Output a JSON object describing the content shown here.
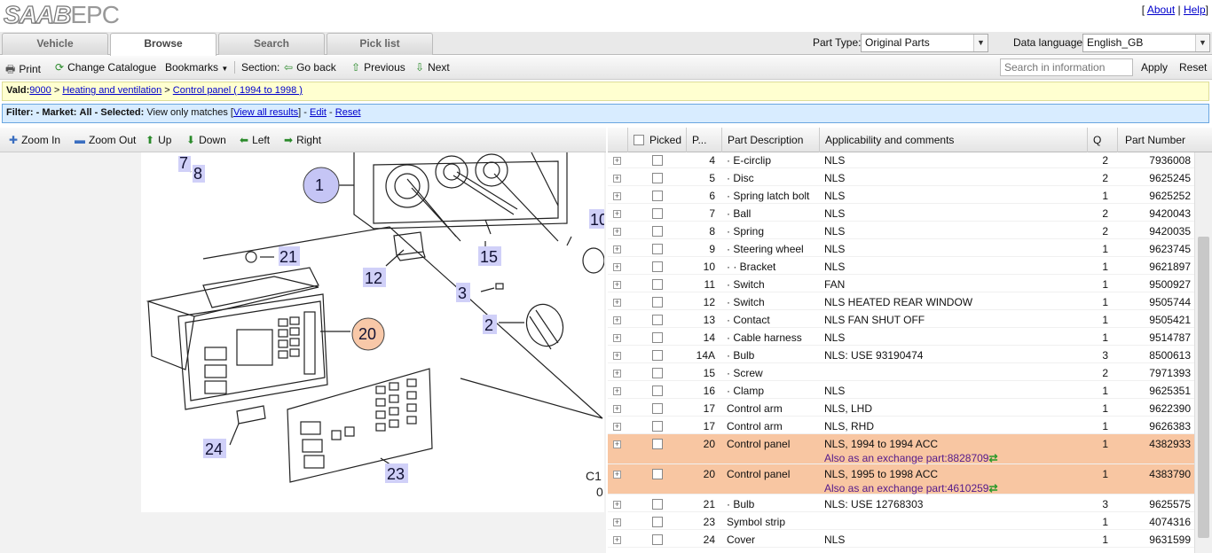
{
  "brand": {
    "logo_bold": "SAAB",
    "logo_light": "EPC"
  },
  "top_links": {
    "about": "About",
    "help": "Help"
  },
  "tabs": [
    "Vehicle",
    "Browse",
    "Search",
    "Pick list"
  ],
  "part_type": {
    "label": "Part Type:",
    "value": "Original Parts"
  },
  "data_language": {
    "label": "Data language:",
    "value": "English_GB"
  },
  "toolbar": {
    "print": "Print",
    "change_catalogue": "Change Catalogue",
    "bookmarks": "Bookmarks",
    "section": "Section:",
    "go_back": "Go back",
    "previous": "Previous",
    "next": "Next",
    "search_placeholder": "Search in information",
    "apply": "Apply",
    "reset": "Reset"
  },
  "breadcrumb": {
    "label": "Vald:",
    "model": "9000",
    "group": "Heating and ventilation",
    "section": "Control panel ( 1994 to 1998 )"
  },
  "filter": {
    "label": "Filter:",
    "market_label": "- Market:",
    "market": "All",
    "selected_label": "- Selected:",
    "selected": "View only matches",
    "view_all": "View all results",
    "edit": "Edit",
    "reset": "Reset"
  },
  "image_toolbar": {
    "zoom_in": "Zoom In",
    "zoom_out": "Zoom Out",
    "up": "Up",
    "down": "Down",
    "left": "Left",
    "right": "Right"
  },
  "diagram_labels": {
    "c1": "C1",
    "c0": "0"
  },
  "colors": {
    "highlight_row": "#f8c6a2",
    "valid_bg": "#ffffd0",
    "filter_bg": "#d8ecff",
    "callout_blue": "#c5c5f5",
    "callout_orange": "#f8c8a8"
  },
  "table": {
    "headers": [
      "Picked",
      "P...",
      "Part Description",
      "Applicability and comments",
      "Q",
      "Part Number"
    ],
    "rows": [
      {
        "pos": "4",
        "desc": "· E-circlip",
        "app": "NLS",
        "q": "2",
        "num": "7936008"
      },
      {
        "pos": "5",
        "desc": "· Disc",
        "app": "NLS",
        "q": "2",
        "num": "9625245"
      },
      {
        "pos": "6",
        "desc": "· Spring latch bolt",
        "app": "NLS",
        "q": "1",
        "num": "9625252"
      },
      {
        "pos": "7",
        "desc": "· Ball",
        "app": "NLS",
        "q": "2",
        "num": "9420043"
      },
      {
        "pos": "8",
        "desc": "· Spring",
        "app": "NLS",
        "q": "2",
        "num": "9420035"
      },
      {
        "pos": "9",
        "desc": "· Steering wheel",
        "app": "NLS",
        "q": "1",
        "num": "9623745"
      },
      {
        "pos": "10",
        "desc": "· · Bracket",
        "app": "NLS",
        "q": "1",
        "num": "9621897"
      },
      {
        "pos": "11",
        "desc": "· Switch",
        "app": "FAN",
        "q": "1",
        "num": "9500927"
      },
      {
        "pos": "12",
        "desc": "· Switch",
        "app": "NLS HEATED REAR WINDOW",
        "q": "1",
        "num": "9505744"
      },
      {
        "pos": "13",
        "desc": "· Contact",
        "app": "NLS FAN SHUT OFF",
        "q": "1",
        "num": "9505421"
      },
      {
        "pos": "14",
        "desc": "· Cable harness",
        "app": "NLS",
        "q": "1",
        "num": "9514787"
      },
      {
        "pos": "14A",
        "desc": "· Bulb",
        "app": "NLS: USE 93190474",
        "q": "3",
        "num": "8500613"
      },
      {
        "pos": "15",
        "desc": "· Screw",
        "app": "",
        "q": "2",
        "num": "7971393"
      },
      {
        "pos": "16",
        "desc": "· Clamp",
        "app": "NLS",
        "q": "1",
        "num": "9625351"
      },
      {
        "pos": "17",
        "desc": "Control arm",
        "app": "NLS, LHD",
        "q": "1",
        "num": "9622390"
      },
      {
        "pos": "17",
        "desc": "Control arm",
        "app": "NLS, RHD",
        "q": "1",
        "num": "9626383"
      },
      {
        "pos": "20",
        "desc": "Control panel",
        "app": "NLS, 1994 to 1994 ACC",
        "q": "1",
        "num": "4382933",
        "exchange": "Also as an exchange part:8828709"
      },
      {
        "pos": "20",
        "desc": "Control panel",
        "app": "NLS, 1995 to 1998 ACC",
        "q": "1",
        "num": "4383790",
        "exchange": "Also as an exchange part:4610259"
      },
      {
        "pos": "21",
        "desc": "· Bulb",
        "app": "NLS: USE 12768303",
        "q": "3",
        "num": "9625575"
      },
      {
        "pos": "23",
        "desc": "Symbol strip",
        "app": "",
        "q": "1",
        "num": "4074316"
      },
      {
        "pos": "24",
        "desc": "Cover",
        "app": "NLS",
        "q": "1",
        "num": "9631599"
      }
    ]
  }
}
